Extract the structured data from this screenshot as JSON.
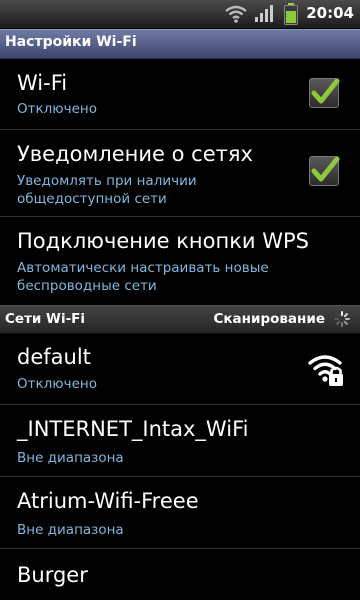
{
  "status_bar": {
    "time": "20:04"
  },
  "title_bar": {
    "title": "Настройки Wi-Fi"
  },
  "settings": [
    {
      "title": "Wi-Fi",
      "subtitle": "Отключено",
      "checked": true
    },
    {
      "title": "Уведомление о сетях",
      "subtitle_lines": [
        "Уведомлять при наличии",
        "общедоступной сети"
      ],
      "checked": true
    },
    {
      "title": "Подключение кнопки WPS",
      "subtitle_lines": [
        "Автоматически настраивать новые",
        "беспроводные сети"
      ]
    }
  ],
  "networks_section": {
    "label": "Сети Wi-Fi",
    "scan_label": "Сканирование"
  },
  "networks": [
    {
      "name": "default",
      "status": "Отключено",
      "icon": "wifi-lock-icon"
    },
    {
      "name": "_INTERNET_Intax_WiFi",
      "status": "Вне диапазона"
    },
    {
      "name": "Atrium-Wifi-Freee",
      "status": "Вне диапазона"
    },
    {
      "name": "Burger",
      "status": ""
    }
  ],
  "colors": {
    "subtitle": "#7fb8de",
    "check": "#8fc83c",
    "title_bar": "#4d5780"
  }
}
